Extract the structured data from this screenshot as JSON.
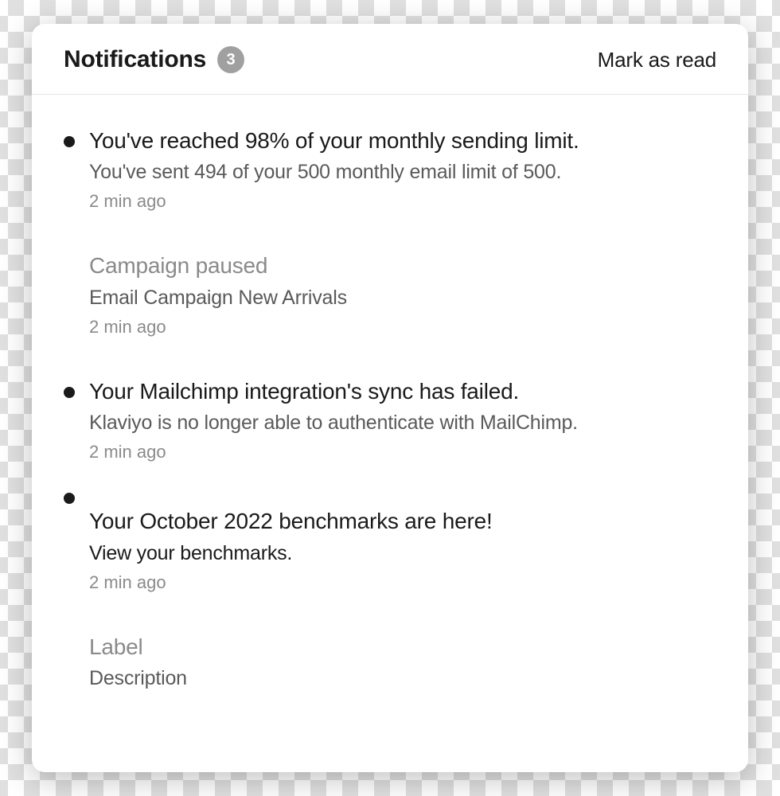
{
  "header": {
    "title": "Notifications",
    "count": "3",
    "mark_read": "Mark as read"
  },
  "notifications": [
    {
      "unread": true,
      "title": "You've reached 98% of your monthly sending limit.",
      "desc": "You've sent 494 of your 500 monthly email limit of 500.",
      "time": "2 min ago",
      "muted": false,
      "desc_strong": false
    },
    {
      "unread": false,
      "title": "Campaign paused",
      "desc": "Email Campaign New Arrivals",
      "time": "2 min ago",
      "muted": true,
      "desc_strong": false
    },
    {
      "unread": true,
      "title": "Your Mailchimp integration's sync has failed.",
      "desc": "Klaviyo is no longer able to authenticate with MailChimp.",
      "time": "2 min ago",
      "muted": false,
      "desc_strong": false
    },
    {
      "unread": true,
      "title": "Your October 2022 benchmarks are here!",
      "desc": "View your benchmarks.",
      "time": "2 min ago",
      "muted": false,
      "desc_strong": true,
      "offset": true
    },
    {
      "unread": false,
      "title": "Label",
      "desc": "Description",
      "time": "",
      "muted": true,
      "desc_strong": false
    }
  ]
}
